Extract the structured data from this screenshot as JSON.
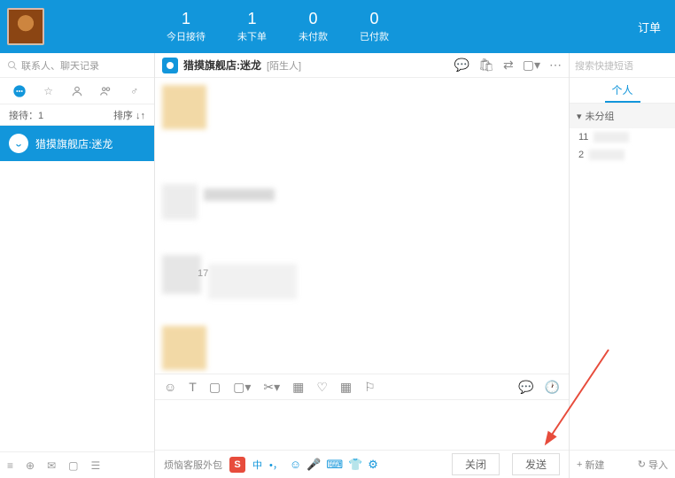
{
  "header": {
    "stats": [
      {
        "num": "1",
        "lbl": "今日接待"
      },
      {
        "num": "1",
        "lbl": "未下单"
      },
      {
        "num": "0",
        "lbl": "未付款"
      },
      {
        "num": "0",
        "lbl": "已付款"
      }
    ],
    "right_tab": "订单"
  },
  "left": {
    "search_placeholder": "联系人、聊天记录",
    "status": {
      "receive": "接待：1",
      "sort": "排序 ↓↑"
    },
    "contact": {
      "name": "猎摸旗舰店:迷龙"
    }
  },
  "chat": {
    "title": "猎摸旗舰店:迷龙",
    "tag": "[陌生人]",
    "body_num": "17"
  },
  "toolbar": {
    "close": "关闭",
    "send": "发送",
    "footer_text": "烦恼客服外包",
    "ime_text": "中"
  },
  "right": {
    "search_placeholder": "搜索快捷短语",
    "tab": "个人",
    "group": "未分组",
    "items": [
      {
        "num": "11"
      },
      {
        "num": "2"
      }
    ],
    "new_btn": "新建",
    "import_btn": "导入"
  },
  "icons": {
    "search": "search-icon",
    "chevron": "▸",
    "plus": "+"
  }
}
